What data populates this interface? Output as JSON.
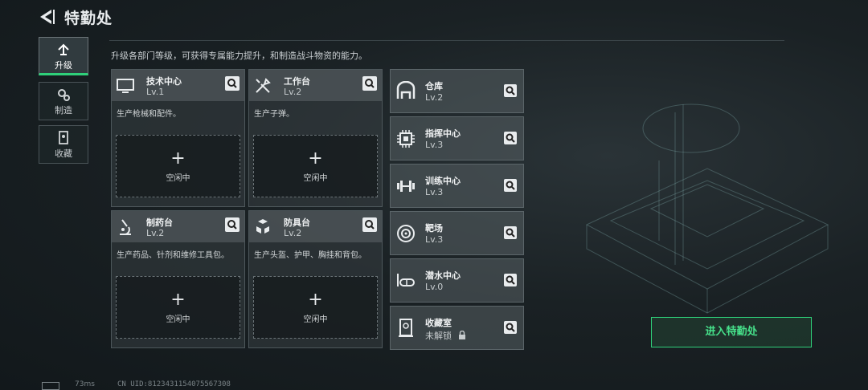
{
  "header": {
    "title": "特勤处"
  },
  "description": "升级各部门等级，可获得专属能力提升，和制造战斗物资的能力。",
  "tabs": [
    {
      "label": "升级",
      "icon": "upgrade-icon",
      "active": true
    },
    {
      "label": "制造",
      "icon": "gears-icon",
      "active": false
    },
    {
      "label": "收藏",
      "icon": "collection-icon",
      "active": false
    }
  ],
  "cards": [
    {
      "name": "技术中心",
      "level": "Lv.1",
      "desc": "生产枪械和配件。",
      "slot": "空闲中",
      "icon": "computer-icon"
    },
    {
      "name": "工作台",
      "level": "Lv.2",
      "desc": "生产子弹。",
      "slot": "空闲中",
      "icon": "tools-icon"
    },
    {
      "name": "制药台",
      "level": "Lv.2",
      "desc": "生产药品、针剂和维修工具包。",
      "slot": "空闲中",
      "icon": "microscope-icon"
    },
    {
      "name": "防具台",
      "level": "Lv.2",
      "desc": "生产头盔、护甲、胸挂和背包。",
      "slot": "空闲中",
      "icon": "armor-boxes-icon"
    }
  ],
  "slot_plus": "+",
  "rooms": [
    {
      "name": "仓库",
      "level": "Lv.2",
      "icon": "warehouse-icon"
    },
    {
      "name": "指挥中心",
      "level": "Lv.3",
      "icon": "chip-icon"
    },
    {
      "name": "训练中心",
      "level": "Lv.3",
      "icon": "dumbbell-icon"
    },
    {
      "name": "靶场",
      "level": "Lv.3",
      "icon": "target-icon"
    },
    {
      "name": "潜水中心",
      "level": "Lv.0",
      "icon": "diving-mask-icon"
    },
    {
      "name": "收藏室",
      "level": "未解锁",
      "icon": "display-case-icon",
      "locked": true
    }
  ],
  "enter_button": "进入特勤处",
  "status": {
    "ping": "73ms",
    "uid": "CN UID:8123431154075567308"
  },
  "colors": {
    "accent": "#2fd07a"
  }
}
